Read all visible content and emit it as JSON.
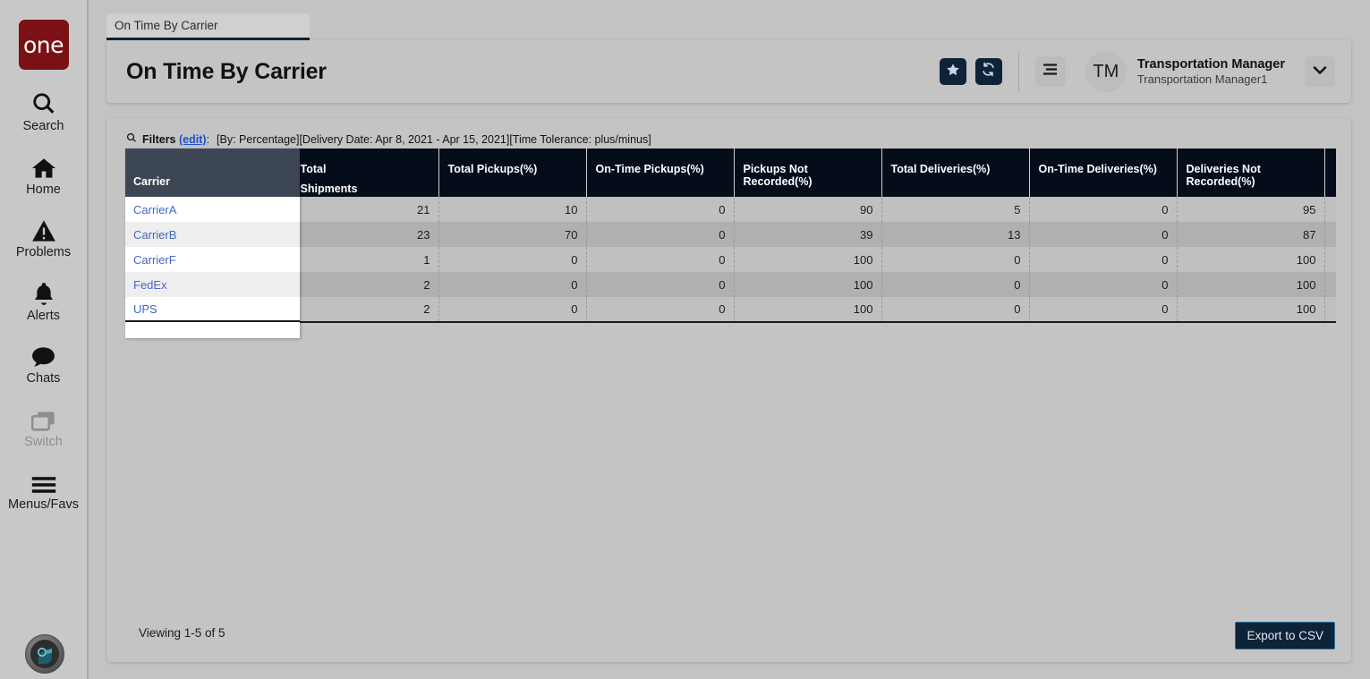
{
  "brand": {
    "logo_text": "one",
    "logo_color": "#7a1116"
  },
  "sidebar": {
    "items": [
      {
        "label": "Search",
        "icon": "search-icon",
        "disabled": false
      },
      {
        "label": "Home",
        "icon": "home-icon",
        "disabled": false
      },
      {
        "label": "Problems",
        "icon": "warning-triangle-icon",
        "disabled": false
      },
      {
        "label": "Alerts",
        "icon": "bell-icon",
        "disabled": false
      },
      {
        "label": "Chats",
        "icon": "chat-bubble-icon",
        "disabled": false
      },
      {
        "label": "Switch",
        "icon": "switch-windows-icon",
        "disabled": true
      },
      {
        "label": "Menus/Favs",
        "icon": "hamburger-icon",
        "disabled": false
      }
    ]
  },
  "tab": {
    "label": "On Time By Carrier"
  },
  "header": {
    "title": "On Time By Carrier",
    "favorite_icon": "star-icon",
    "refresh_icon": "refresh-icon",
    "menu_icon": "list-menu-icon",
    "avatar_initials": "TM",
    "user_name": "Transportation Manager",
    "user_subtitle": "Transportation Manager1",
    "dropdown_icon": "chevron-down-icon",
    "accent_color": "#0d2338"
  },
  "filters": {
    "search_icon": "search-icon",
    "label": "Filters",
    "edit_label": "(edit)",
    "colon": ":",
    "values": "[By: Percentage][Delivery Date: Apr 8, 2021 - Apr 15, 2021][Time Tolerance: plus/minus]"
  },
  "table": {
    "columns": [
      "Carrier",
      "Total\nShipments",
      "Total Pickups(%)",
      "On-Time Pickups(%)",
      "Pickups Not Recorded(%)",
      "Total Deliveries(%)",
      "On-Time Deliveries(%)",
      "Deliveries Not Recorded(%)",
      ""
    ],
    "column_total_shipments_line1": "Total",
    "column_total_shipments_line2": "Shipments",
    "rows": [
      {
        "carrier": "CarrierA",
        "total_shipments": "21",
        "total_pickups": "10",
        "on_time_pickups": "0",
        "pickups_not_recorded": "90",
        "total_deliveries": "5",
        "on_time_deliveries": "0",
        "deliveries_not_recorded": "95"
      },
      {
        "carrier": "CarrierB",
        "total_shipments": "23",
        "total_pickups": "70",
        "on_time_pickups": "0",
        "pickups_not_recorded": "39",
        "total_deliveries": "13",
        "on_time_deliveries": "0",
        "deliveries_not_recorded": "87"
      },
      {
        "carrier": "CarrierF",
        "total_shipments": "1",
        "total_pickups": "0",
        "on_time_pickups": "0",
        "pickups_not_recorded": "100",
        "total_deliveries": "0",
        "on_time_deliveries": "0",
        "deliveries_not_recorded": "100"
      },
      {
        "carrier": "FedEx",
        "total_shipments": "2",
        "total_pickups": "0",
        "on_time_pickups": "0",
        "pickups_not_recorded": "100",
        "total_deliveries": "0",
        "on_time_deliveries": "0",
        "deliveries_not_recorded": "100"
      },
      {
        "carrier": "UPS",
        "total_shipments": "2",
        "total_pickups": "0",
        "on_time_pickups": "0",
        "pickups_not_recorded": "100",
        "total_deliveries": "0",
        "on_time_deliveries": "0",
        "deliveries_not_recorded": "100"
      }
    ]
  },
  "footer": {
    "viewing": "Viewing 1-5 of 5",
    "export_label": "Export to CSV"
  }
}
